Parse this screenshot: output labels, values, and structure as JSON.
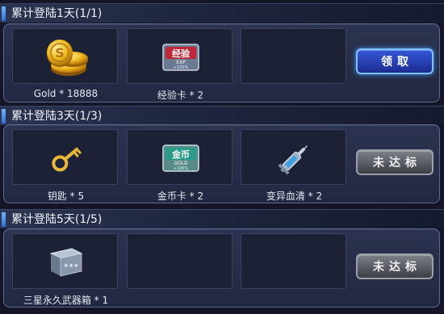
{
  "sections": [
    {
      "title": "累计登陆1天(1/1)",
      "rewards": [
        {
          "icon": "gold-coins-icon",
          "label": "Gold * 18888"
        },
        {
          "icon": "exp-card-icon",
          "label": "经验卡 * 2",
          "card_text": "经验",
          "card_sub": "EXP",
          "card_pct": "+100%"
        },
        {
          "icon": "",
          "label": ""
        }
      ],
      "button": {
        "label": "领取",
        "state": "claimable"
      }
    },
    {
      "title": "累计登陆3天(1/3)",
      "rewards": [
        {
          "icon": "key-icon",
          "label": "钥匙 * 5"
        },
        {
          "icon": "gold-card-icon",
          "label": "金币卡 * 2",
          "card_text": "金币",
          "card_sub": "GOLD",
          "card_pct": "+100%"
        },
        {
          "icon": "syringe-icon",
          "label": "变异血清 * 2"
        }
      ],
      "button": {
        "label": "未达标",
        "state": "disabled"
      }
    },
    {
      "title": "累计登陆5天(1/5)",
      "rewards": [
        {
          "icon": "weapon-crate-icon",
          "label": "三星永久武器箱 * 1",
          "crate_stars": "★★★"
        },
        {
          "icon": "",
          "label": ""
        },
        {
          "icon": "",
          "label": ""
        }
      ],
      "button": {
        "label": "未达标",
        "state": "disabled"
      }
    }
  ],
  "colors": {
    "claim_button": "#2a44c0",
    "disabled_button": "#5a5e66",
    "panel_border": "#5d6a90",
    "header_accent": "#4a90ff"
  }
}
